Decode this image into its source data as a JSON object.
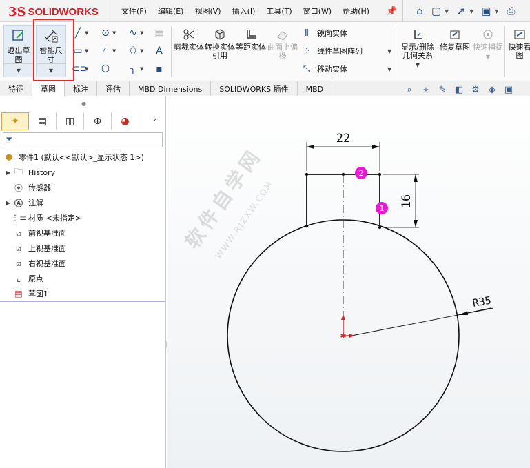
{
  "app": {
    "logo_prefix": "3S",
    "logo_solid": "SOLID",
    "logo_works": "WORKS",
    "menu": [
      "文件(F)",
      "编辑(E)",
      "视图(V)",
      "插入(I)",
      "工具(T)",
      "窗口(W)",
      "帮助(H)"
    ]
  },
  "quick_access": [
    "home-icon",
    "new-document-icon",
    "open-icon",
    "save-icon",
    "print-icon"
  ],
  "ribbon": {
    "exit_sketch": "退出草图",
    "smart_dimension": "智能尺寸",
    "trim": "剪裁实体",
    "convert": "转换实体引用",
    "offset": "等距实体",
    "surface_offset": "曲面上偏移",
    "mirror": "镜向实体",
    "linear_pattern": "线性草图阵列",
    "move": "移动实体",
    "relations": "显示/删除几何关系",
    "repair": "修复草图",
    "quick_snap": "快速捕捉",
    "quick_view": "快速看图"
  },
  "tabs": [
    "特征",
    "草图",
    "标注",
    "评估",
    "MBD Dimensions",
    "SOLIDWORKS 插件",
    "MBD"
  ],
  "active_tab": "草图",
  "tree": {
    "root": "零件1  (默认<<默认>_显示状态 1>)",
    "items": [
      {
        "label": "History",
        "icon": "history-folder-icon",
        "expand": true
      },
      {
        "label": "传感器",
        "icon": "sensor-icon",
        "expand": false
      },
      {
        "label": "注解",
        "icon": "annotation-icon",
        "expand": true
      },
      {
        "label": "材质 <未指定>",
        "icon": "material-icon",
        "expand": false
      },
      {
        "label": "前视基准面",
        "icon": "plane-icon",
        "expand": false
      },
      {
        "label": "上视基准面",
        "icon": "plane-icon",
        "expand": false
      },
      {
        "label": "右视基准面",
        "icon": "plane-icon",
        "expand": false
      },
      {
        "label": "原点",
        "icon": "origin-icon",
        "expand": false
      },
      {
        "label": "草图1",
        "icon": "sketch-icon",
        "expand": false
      }
    ]
  },
  "sketch": {
    "dim_width": "22",
    "dim_height": "16",
    "dim_radius": "R35",
    "marker_1": "1",
    "marker_2": "2"
  },
  "watermark": {
    "text": "软件自学网",
    "url": "WWW.RJZXW.COM"
  }
}
